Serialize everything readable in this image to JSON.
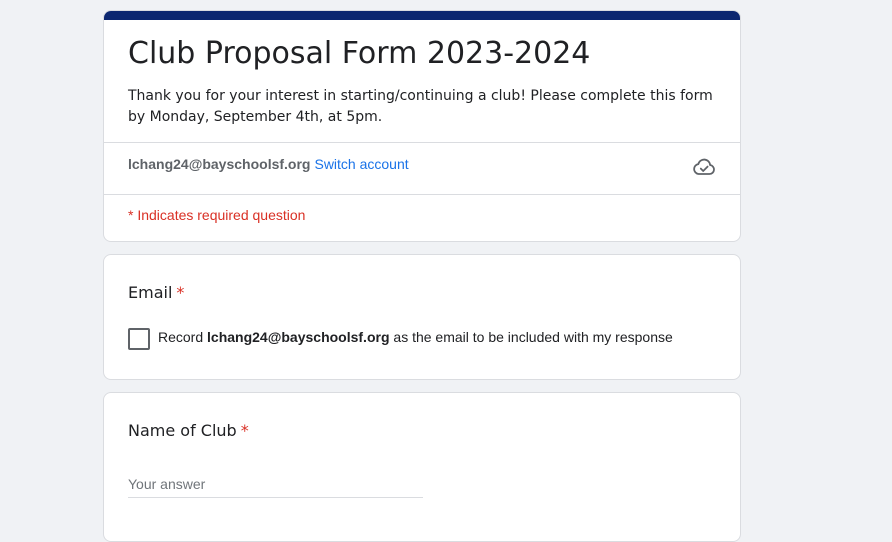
{
  "form": {
    "title": "Club Proposal Form 2023-2024",
    "description": "Thank you for your interest in starting/continuing a club! Please complete this form by Monday, September 4th, at 5pm.",
    "header_color": "#0c2770"
  },
  "account": {
    "email": "lchang24@bayschoolsf.org",
    "switch_label": "Switch account",
    "icon": "cloud-saved-icon"
  },
  "required_note": "* Indicates required question",
  "questions": [
    {
      "title": "Email",
      "required_mark": "*",
      "checkbox": {
        "prefix": "Record ",
        "email": "lchang24@bayschoolsf.org",
        "suffix": " as the email to be included with my response",
        "checked": false
      }
    },
    {
      "title": "Name of Club",
      "required_mark": "*",
      "placeholder": "Your answer",
      "value": ""
    }
  ],
  "colors": {
    "accent_link": "#1a73e8",
    "required": "#d93025",
    "background": "#f0f2f5"
  }
}
